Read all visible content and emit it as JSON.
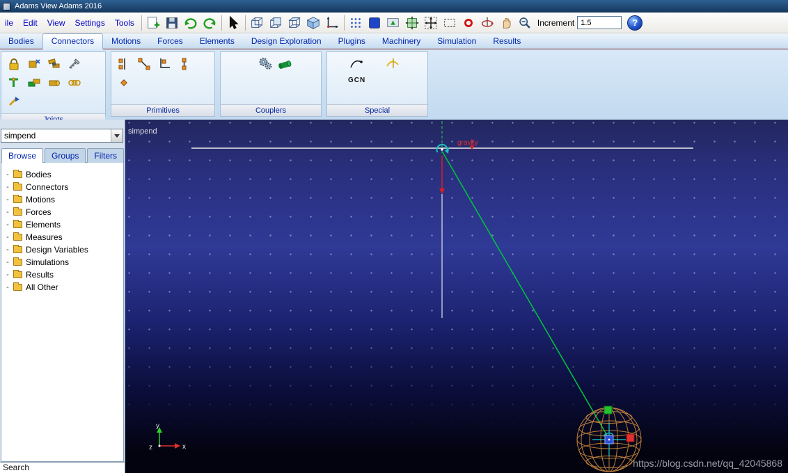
{
  "title_bar": {
    "title": "Adams View Adams 2016"
  },
  "menus": [
    {
      "label": "ile"
    },
    {
      "label": "Edit"
    },
    {
      "label": "View"
    },
    {
      "label": "Settings"
    },
    {
      "label": "Tools"
    }
  ],
  "toolbar": {
    "increment_label": "Increment",
    "increment_value": "1.5"
  },
  "icons": {
    "help_glyph": "?"
  },
  "ribbon": {
    "tabs": [
      {
        "label": "Bodies"
      },
      {
        "label": "Connectors"
      },
      {
        "label": "Motions"
      },
      {
        "label": "Forces"
      },
      {
        "label": "Elements"
      },
      {
        "label": "Design Exploration"
      },
      {
        "label": "Plugins"
      },
      {
        "label": "Machinery"
      },
      {
        "label": "Simulation"
      },
      {
        "label": "Results"
      }
    ],
    "selected_tab": "Connectors",
    "groups": {
      "joints": "Joints",
      "primitives": "Primitives",
      "couplers": "Couplers",
      "special": "Special",
      "gcn": "GCN"
    }
  },
  "sidebar": {
    "model_selector_value": "simpend",
    "expander_glyph": "-",
    "tabs": [
      {
        "label": "Browse"
      },
      {
        "label": "Groups"
      },
      {
        "label": "Filters"
      }
    ],
    "tree_items": [
      {
        "label": "Bodies"
      },
      {
        "label": "Connectors"
      },
      {
        "label": "Motions"
      },
      {
        "label": "Forces"
      },
      {
        "label": "Elements"
      },
      {
        "label": "Measures"
      },
      {
        "label": "Design Variables"
      },
      {
        "label": "Simulations"
      },
      {
        "label": "Results"
      },
      {
        "label": "All Other"
      }
    ],
    "search_label": "Search"
  },
  "viewport": {
    "model_name_label": "simpend",
    "gravity_label": "gravity",
    "triad": {
      "x_label": "x",
      "y_label": "y",
      "z_label": "z"
    },
    "watermark": "https://blog.csdn.net/qq_42045868"
  },
  "colors": {
    "menu_blue": "#0000cc",
    "tab_blue": "#0026b0",
    "viewport_top": "#23275f",
    "viewport_mid": "#2f3a96",
    "viewport_bottom": "#030310",
    "pendulum_green": "#00c040",
    "sphere_wire": "#c8863c",
    "gravity_red": "#d42020"
  }
}
